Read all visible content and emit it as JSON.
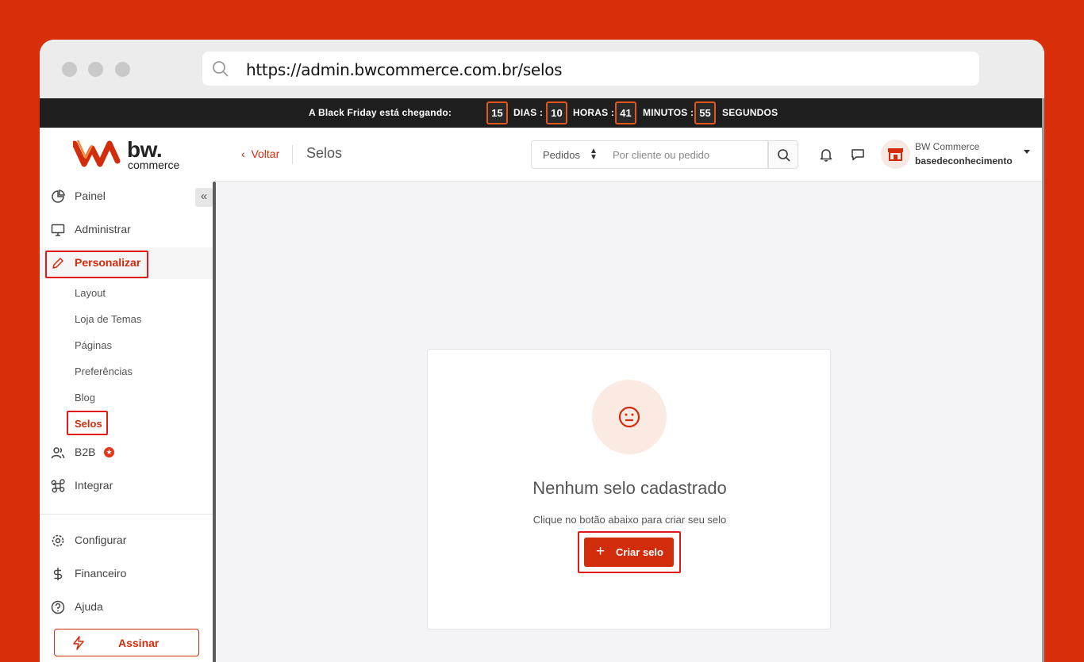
{
  "browser": {
    "url": "https://admin.bwcommerce.com.br/selos"
  },
  "promo": {
    "headline": "A Black Friday está chegando:",
    "days": "15",
    "days_label": "DIAS :",
    "hours": "10",
    "hours_label": "HORAS :",
    "minutes": "41",
    "minutes_label": "MINUTOS :",
    "seconds": "55",
    "seconds_label": "SEGUNDOS"
  },
  "logo": {
    "brand": "bw.",
    "sub": "commerce"
  },
  "sidebar": {
    "items": [
      {
        "label": "Painel",
        "icon": "pie-chart-icon"
      },
      {
        "label": "Administrar",
        "icon": "monitor-icon"
      },
      {
        "label": "Personalizar",
        "icon": "pencil-icon"
      },
      {
        "label": "B2B",
        "icon": "users-icon"
      },
      {
        "label": "Integrar",
        "icon": "command-icon"
      },
      {
        "label": "Configurar",
        "icon": "gear-icon"
      },
      {
        "label": "Financeiro",
        "icon": "dollar-icon"
      },
      {
        "label": "Ajuda",
        "icon": "help-icon"
      }
    ],
    "subitems": [
      "Layout",
      "Loja de Temas",
      "Páginas",
      "Preferências",
      "Blog",
      "Selos"
    ],
    "subscribe_label": "Assinar",
    "collapse_glyph": "«"
  },
  "topbar": {
    "back_label": "Voltar",
    "page_title": "Selos",
    "select_value": "Pedidos",
    "search_placeholder": "Por cliente ou pedido",
    "user_name": "BW Commerce",
    "user_account": "basedeconhecimento"
  },
  "empty_state": {
    "title": "Nenhum selo cadastrado",
    "subtitle": "Clique no botão abaixo para criar seu selo",
    "button_label": "Criar selo"
  },
  "colors": {
    "brand": "#d12c0c",
    "background": "#d92e0a",
    "highlight": "#e01a1a"
  }
}
